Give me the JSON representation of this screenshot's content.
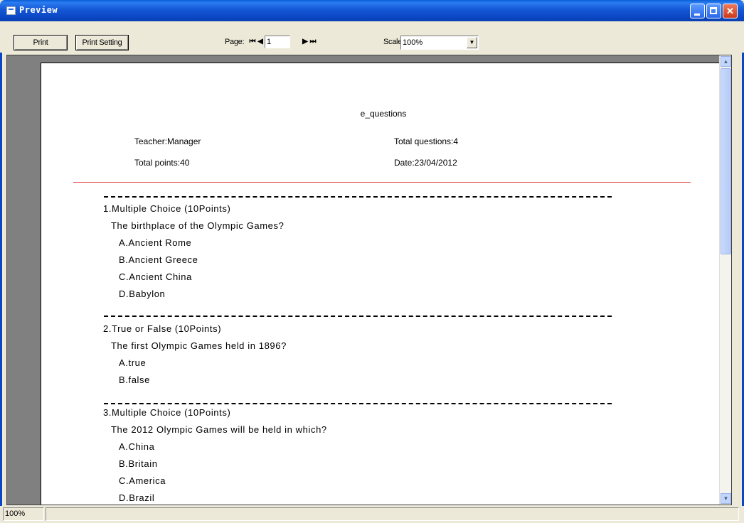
{
  "window": {
    "title": "Preview"
  },
  "toolbar": {
    "print_label": "Print",
    "print_setting_label": "Print Setting",
    "page_label": "Page:",
    "page_value": "1",
    "scale_label": "Scale",
    "scale_value": "100%"
  },
  "document": {
    "title": "e_questions",
    "teacher": "Teacher:Manager",
    "total_questions": "Total questions:4",
    "total_points": "Total points:40",
    "date": "Date:23/04/2012",
    "questions": [
      {
        "header": "1.Multiple Choice  (10Points)",
        "text": "The birthplace of the Olympic Games?",
        "options": [
          "A.Ancient Rome",
          "B.Ancient Greece",
          "C.Ancient China",
          "D.Babylon"
        ]
      },
      {
        "header": "2.True or False  (10Points)",
        "text": "The first Olympic Games held in 1896?",
        "options": [
          "A.true",
          "B.false"
        ]
      },
      {
        "header": "3.Multiple Choice  (10Points)",
        "text": "The 2012 Olympic Games will be held in which?",
        "options": [
          "A.China",
          "B.Britain",
          "C.America",
          "D.Brazil"
        ]
      }
    ]
  },
  "status": {
    "zoom": "100%"
  }
}
